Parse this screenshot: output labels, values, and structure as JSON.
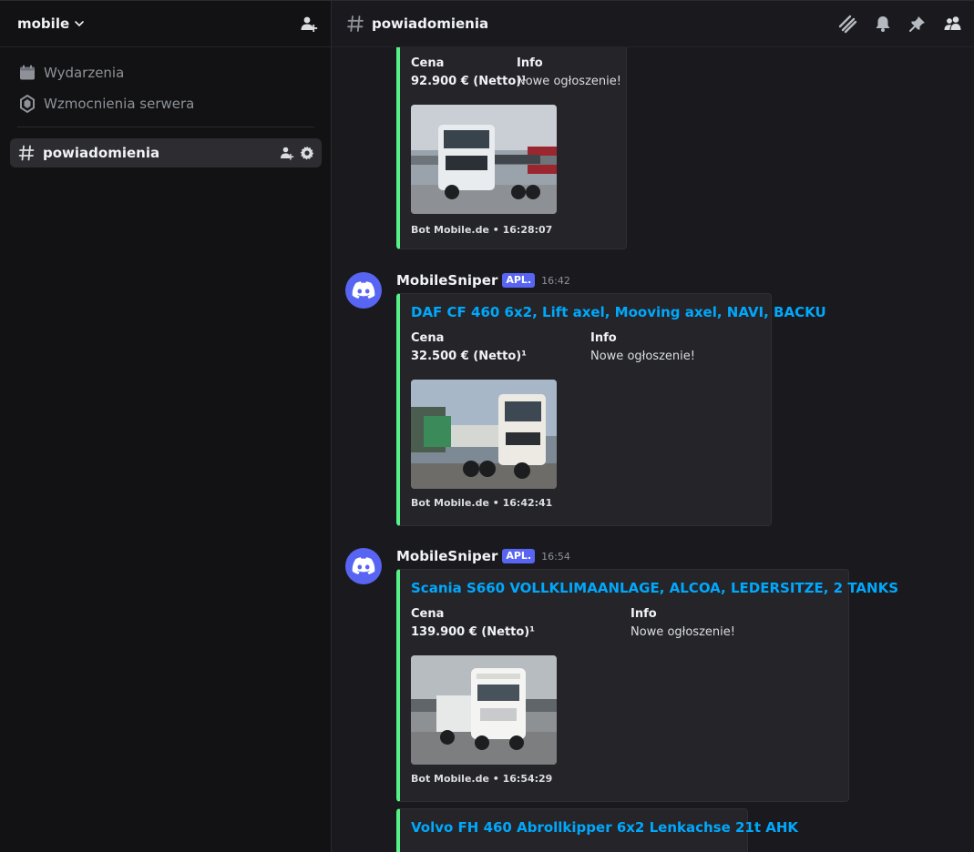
{
  "server": {
    "name": "mobile"
  },
  "sidebar": {
    "items": [
      {
        "label": "Wydarzenia",
        "icon": "calendar-icon"
      },
      {
        "label": "Wzmocnienia serwera",
        "icon": "boost-icon"
      }
    ],
    "channel": {
      "name": "powiadomienia"
    }
  },
  "header": {
    "channel_name": "powiadomienia"
  },
  "colors": {
    "accent": "#5865f2",
    "embed_border": "#57f287",
    "link": "#00a8fc"
  },
  "messages": [
    {
      "author": "",
      "badge": "",
      "time": "",
      "embed": {
        "title": "",
        "fields": [
          {
            "name": "Cena",
            "value": "92.900 € (Netto)¹"
          },
          {
            "name": "Info",
            "value": "Nowe ogłoszenie!"
          }
        ],
        "footer": "Bot Mobile.de • 16:28:07"
      }
    },
    {
      "author": "MobileSniper",
      "badge": "APL.",
      "time": "16:42",
      "embed": {
        "title": "DAF CF 460 6x2, Lift axel, Mooving axel, NAVI, BACKU",
        "fields": [
          {
            "name": "Cena",
            "value": "32.500 € (Netto)¹"
          },
          {
            "name": "Info",
            "value": "Nowe ogłoszenie!"
          }
        ],
        "footer": "Bot Mobile.de • 16:42:41"
      }
    },
    {
      "author": "MobileSniper",
      "badge": "APL.",
      "time": "16:54",
      "embed": {
        "title": "Scania S660 VOLLKLIMAANLAGE, ALCOA, LEDERSITZE, 2 TANKS",
        "fields": [
          {
            "name": "Cena",
            "value": "139.900 € (Netto)¹"
          },
          {
            "name": "Info",
            "value": "Nowe ogłoszenie!"
          }
        ],
        "footer": "Bot Mobile.de • 16:54:29"
      }
    },
    {
      "author": "",
      "badge": "",
      "time": "",
      "embed": {
        "title": "Volvo FH 460 Abrollkipper 6x2 Lenkachse 21t AHK",
        "fields": [],
        "footer": ""
      }
    }
  ]
}
